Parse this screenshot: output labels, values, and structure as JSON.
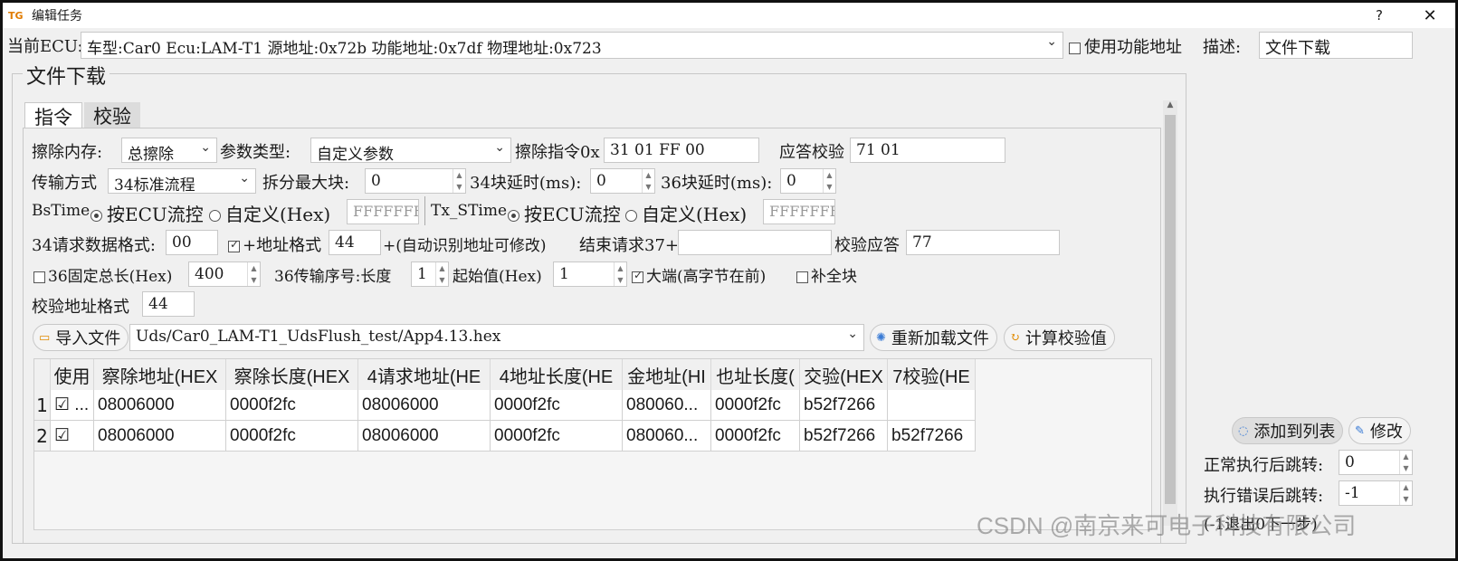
{
  "window": {
    "title": "编辑任务",
    "help": "?",
    "close": "✕",
    "app_icon": "TG"
  },
  "top": {
    "ecu_label": "当前ECU:",
    "ecu_value": "车型:Car0 Ecu:LAM-T1 源地址:0x72b 功能地址:0x7df 物理地址:0x723",
    "use_func_addr": "使用功能地址",
    "desc_label": "描述:",
    "desc_value": "文件下载"
  },
  "group": {
    "title": "文件下载"
  },
  "tabs": [
    {
      "label": "指令"
    },
    {
      "label": "校验"
    }
  ],
  "row1": {
    "erase_mem_label": "擦除内存:",
    "erase_mem_value": "总擦除",
    "param_type_label": "参数类型:",
    "param_type_value": "自定义参数",
    "erase_cmd_label": "擦除指令0x",
    "erase_cmd_value": "31 01 FF 00",
    "resp_check_label": "应答校验",
    "resp_check_value": "71 01"
  },
  "row2": {
    "transfer_label": "传输方式",
    "transfer_value": "34标准流程",
    "split_max_label": "拆分最大块:",
    "split_max_value": "0",
    "delay34_label": "34块延时(ms):",
    "delay34_value": "0",
    "delay36_label": "36块延时(ms):",
    "delay36_value": "0"
  },
  "row3": {
    "bstime_label": "BsTime",
    "by_ecu": "按ECU流控",
    "custom_hex": "自定义(Hex)",
    "bstime_value": "FFFFFFFF",
    "txstime_label": "Tx_STime",
    "tx_by_ecu": "按ECU流控",
    "tx_custom_hex": "自定义(Hex)",
    "txstime_value": "FFFFFFFF"
  },
  "row4": {
    "req34_fmt_label": "34请求数据格式:",
    "req34_fmt_value": "00",
    "addr_fmt_label": "+地址格式",
    "addr_fmt_value": "44",
    "auto_hint": "+(自动识别地址可修改)",
    "end_req_label": "结束请求37+",
    "end_req_value": "",
    "check_resp_label": "校验应答",
    "check_resp_value": "77"
  },
  "row5": {
    "fixed_len_label": "36固定总长(Hex)",
    "fixed_len_value": "400",
    "seq_label": "36传输序号:长度",
    "seq_len_value": "1",
    "start_label": "起始值(Hex)",
    "start_value": "1",
    "big_endian_label": "大端(高字节在前)",
    "fill_label": "补全块"
  },
  "row6": {
    "check_addr_label": "校验地址格式",
    "check_addr_value": "44"
  },
  "file": {
    "import_label": "导入文件",
    "path": "Uds/Car0_LAM-T1_UdsFlush_test/App4.13.hex",
    "reload_label": "重新加载文件",
    "calc_label": "计算校验值"
  },
  "table": {
    "headers": [
      "使用",
      "察除地址(HEX",
      "察除长度(HEX",
      "4请求地址(HE",
      "4地址长度(HE",
      "金地址(HI",
      "也址长度(",
      "交验(HEX",
      "7校验(HE"
    ],
    "rows": [
      {
        "num": "1",
        "use": "☑ ...",
        "cells": [
          "08006000",
          "0000f2fc",
          "08006000",
          "0000f2fc",
          "080060...",
          "0000f2fc",
          "b52f7266",
          ""
        ]
      },
      {
        "num": "2",
        "use": "☑",
        "cells": [
          "08006000",
          "0000f2fc",
          "08006000",
          "0000f2fc",
          "080060...",
          "0000f2fc",
          "b52f7266",
          "b52f7266"
        ]
      }
    ]
  },
  "right": {
    "add_to_list": "添加到列表",
    "modify": "修改",
    "jump_ok_label": "正常执行后跳转:",
    "jump_ok_value": "0",
    "jump_err_label": "执行错误后跳转:",
    "jump_err_value": "-1",
    "hint": "(-1退出0下一步)"
  },
  "watermark": "CSDN @南京来可电子科技有限公司"
}
